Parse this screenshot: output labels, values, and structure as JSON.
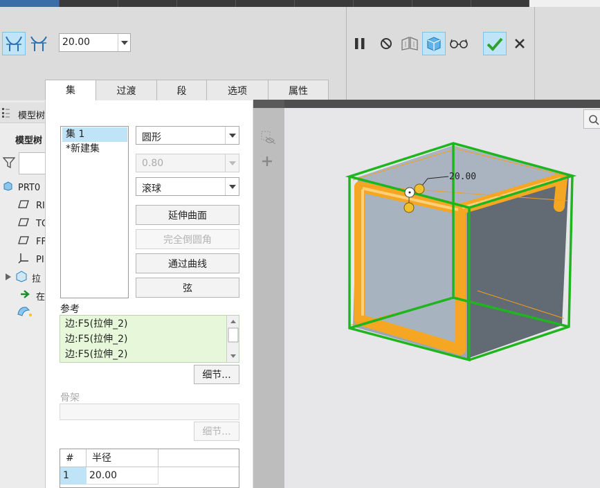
{
  "ribbon": {
    "dimension_value": "20.00",
    "buttons": {
      "type_constant": "round-constant-icon",
      "type_variable": "round-variable-icon",
      "pause": "pause-icon",
      "no_preview": "no-preview-icon",
      "separate_preview": "separate-preview-icon",
      "verify": "verify-icon",
      "glasses": "glasses-icon",
      "ok": "check-icon",
      "cancel": "close-icon"
    }
  },
  "tabs": [
    "集",
    "过渡",
    "段",
    "选项",
    "属性"
  ],
  "tree": {
    "header": "模型树",
    "header2": "模型树",
    "rows": [
      "PRT0",
      "RI",
      "TO",
      "FF",
      "PI",
      "拉",
      "在",
      ""
    ]
  },
  "sets_panel": {
    "sets": [
      "集 1",
      "*新建集"
    ],
    "cross_section": "圆形",
    "conic_param": "0.80",
    "method": "滚球",
    "buttons": [
      "延伸曲面",
      "完全倒圆角",
      "通过曲线",
      "弦"
    ],
    "references_label": "参考",
    "references": [
      "边:F5(拉伸_2)",
      "边:F5(拉伸_2)",
      "边:F5(拉伸_2)"
    ],
    "details_label": "细节...",
    "skeleton_label": "骨架",
    "skeleton_details_label": "细节...",
    "radius_table": {
      "headers": [
        "#",
        "半径"
      ],
      "rows": [
        {
          "num": "1",
          "radius": "20.00"
        }
      ]
    }
  },
  "graphics": {
    "dimension_label": "20.00"
  },
  "colors": {
    "accent": "#bfe4f7",
    "ok_green": "#2ea12e",
    "cube_edge": "#1fb51f",
    "round_orange": "#f5a623",
    "cube_face": "#9aa6b4"
  }
}
